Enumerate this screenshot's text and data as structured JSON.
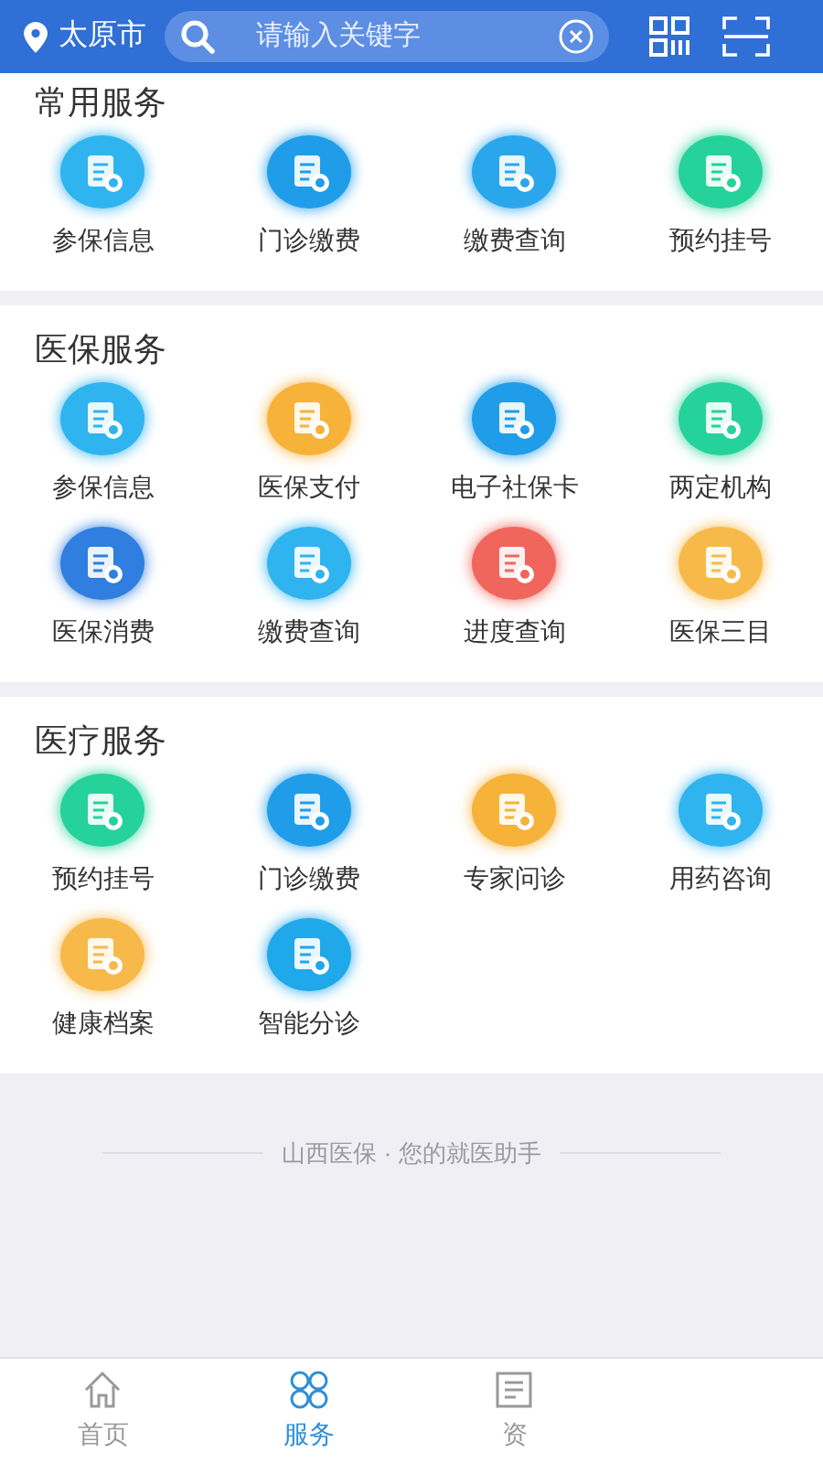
{
  "header": {
    "city": "太原市",
    "search": {
      "placeholder": "请输入关键字"
    }
  },
  "sections": [
    {
      "title": "常用服务",
      "items": [
        {
          "label": "参保信息",
          "color": "#2fb4ef"
        },
        {
          "label": "门诊缴费",
          "color": "#1f9de8"
        },
        {
          "label": "缴费查询",
          "color": "#2aa6ec"
        },
        {
          "label": "预约挂号",
          "color": "#25d39a"
        }
      ]
    },
    {
      "title": "医保服务",
      "items": [
        {
          "label": "参保信息",
          "color": "#2fb4ef"
        },
        {
          "label": "医保支付",
          "color": "#f7b23a"
        },
        {
          "label": "电子社保卡",
          "color": "#1f9de8"
        },
        {
          "label": "两定机构",
          "color": "#25d39a"
        },
        {
          "label": "医保消费",
          "color": "#2f7ee0"
        },
        {
          "label": "缴费查询",
          "color": "#2fb4ef"
        },
        {
          "label": "进度查询",
          "color": "#f0665c"
        },
        {
          "label": "医保三目",
          "color": "#f7b94a"
        }
      ]
    },
    {
      "title": "医疗服务",
      "items": [
        {
          "label": "预约挂号",
          "color": "#25d39a"
        },
        {
          "label": "门诊缴费",
          "color": "#1f9de8"
        },
        {
          "label": "专家问诊",
          "color": "#f7b23a"
        },
        {
          "label": "用药咨询",
          "color": "#2fb4ef"
        },
        {
          "label": "健康档案",
          "color": "#f7b94a"
        },
        {
          "label": "智能分诊",
          "color": "#1fa8ea"
        }
      ]
    }
  ],
  "footer": "山西医保 · 您的就医助手",
  "tabs": [
    {
      "label": "首页",
      "selected": false,
      "kind": "home"
    },
    {
      "label": "服务",
      "selected": true,
      "kind": "grid"
    },
    {
      "label": "资",
      "selected": false,
      "kind": "doc"
    }
  ]
}
